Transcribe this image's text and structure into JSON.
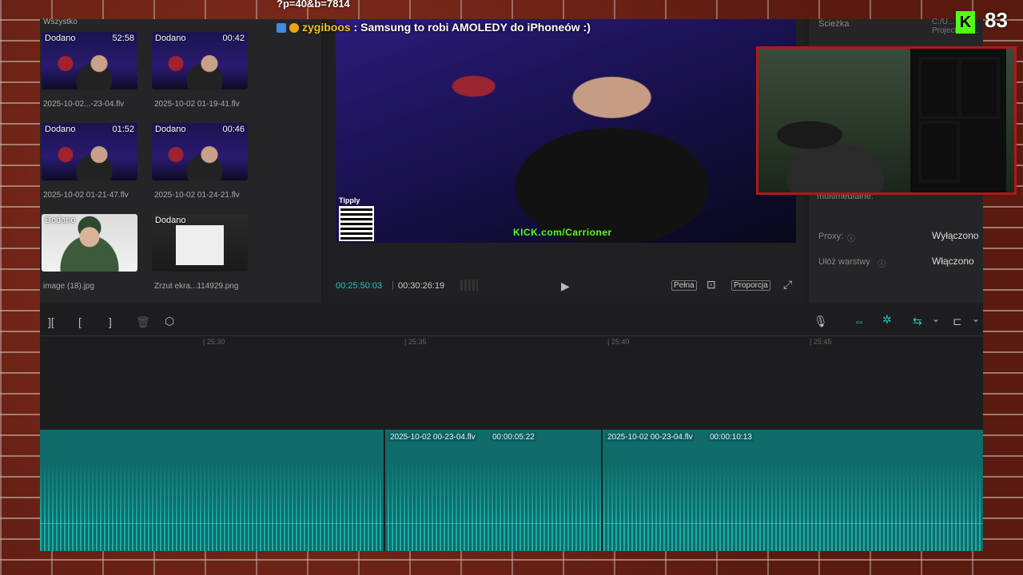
{
  "overlay": {
    "url_fragment": "?p=40&b=7814",
    "chat_user": "zygiboos",
    "chat_message": " : Samsung to robi AMOLEDY do iPhoneów :)",
    "viewer_count": "83",
    "kick_logo": "K",
    "kick_channel": "KICK.com/Carrioner",
    "tipply": "Tipply"
  },
  "media": {
    "filter_tab": "Wszystko",
    "items": [
      {
        "badge": "Dodano",
        "duration": "52:58",
        "name": "2025-10-02...-23-04.flv"
      },
      {
        "badge": "Dodano",
        "duration": "00:42",
        "name": "2025-10-02 01-19-41.flv"
      },
      {
        "badge": "Dodano",
        "duration": "01:52",
        "name": "2025-10-02 01-21-47.flv"
      },
      {
        "badge": "Dodano",
        "duration": "00:46",
        "name": "2025-10-02 01-24-21.flv"
      },
      {
        "badge": "Dodano",
        "duration": "",
        "name": "image (18).jpg"
      },
      {
        "badge": "Dodano",
        "duration": "",
        "name": "Zrzut ekra...114929.png"
      }
    ]
  },
  "player": {
    "current_time": "00:25:50:03",
    "total_time": "00:30:26:19",
    "full_label": "Pełna",
    "ratio_label": "Proporcja"
  },
  "props": {
    "path_label": "Ścieżka",
    "path_value": "C:/U...\nProjects/co...",
    "multimedia_label": "multimedialne:",
    "proxy_label": "Proxy:",
    "proxy_value": "Wyłączono",
    "layers_label": "Ułóż warstwy",
    "layers_value": "Włączono"
  },
  "timeline": {
    "ruler_ticks": [
      "| 25:30",
      "| 25:35",
      "| 25:40",
      "| 25:45"
    ],
    "clips": [
      {
        "file": "2025-10-02 00-23-04.flv",
        "time": "00:00:05:22"
      },
      {
        "file": "2025-10-02 00-23-04.flv",
        "time": "00:00:10:13"
      }
    ]
  },
  "icons": {
    "split": "][",
    "trim_left": "[",
    "trim_right": "]",
    "delete": "🗑",
    "marker": "⬡",
    "mic": "🎙",
    "link": "⇔",
    "snap": "✲",
    "chain": "⇆",
    "chevron": "⌄",
    "ratio": "⊏",
    "play": "▶",
    "screenshot": "⊡",
    "fullscreen": "⤢"
  },
  "colors": {
    "accent": "#20c5c5",
    "audio_track": "#0f6c6a",
    "kick_green": "#53fc18",
    "cam_border": "#b01818"
  }
}
